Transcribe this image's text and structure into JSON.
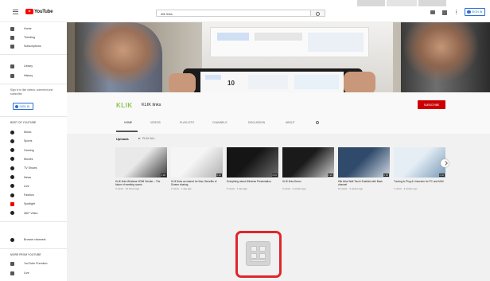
{
  "topbar": {
    "logo_text": "YouTube",
    "search_value": "klik links",
    "signin_label": "SIGN IN"
  },
  "sidebar": {
    "main_items": [
      {
        "label": "Home",
        "icon": "home-icon"
      },
      {
        "label": "Trending",
        "icon": "trending-icon"
      },
      {
        "label": "Subscriptions",
        "icon": "subscriptions-icon"
      }
    ],
    "library_items": [
      {
        "label": "Library",
        "icon": "library-icon"
      },
      {
        "label": "History",
        "icon": "history-icon"
      }
    ],
    "signin_prompt": "Sign in to like videos, comment and subscribe.",
    "signin_label": "SIGN IN",
    "best_heading": "BEST OF YOUTUBE",
    "best_items": [
      {
        "label": "Music",
        "icon": "music-icon"
      },
      {
        "label": "Sports",
        "icon": "sports-icon"
      },
      {
        "label": "Gaming",
        "icon": "gaming-icon"
      },
      {
        "label": "Movies",
        "icon": "movies-icon"
      },
      {
        "label": "TV Shows",
        "icon": "tv-shows-icon"
      },
      {
        "label": "News",
        "icon": "news-icon"
      },
      {
        "label": "Live",
        "icon": "live-icon"
      },
      {
        "label": "Fashion",
        "icon": "fashion-icon"
      },
      {
        "label": "Spotlight",
        "icon": "spotlight-icon"
      },
      {
        "label": "360° Video",
        "icon": "360-video-icon"
      }
    ],
    "browse_label": "Browse channels",
    "more_heading": "MORE FROM YOUTUBE",
    "more_items": [
      {
        "label": "YouTube Premium",
        "icon": "youtube-premium-icon"
      },
      {
        "label": "Live",
        "icon": "live-icon"
      }
    ]
  },
  "banner": {
    "tablet_number": "10"
  },
  "channel": {
    "logo_text": "KLIK",
    "name": "KLIK links",
    "subscribe_label": "SUBSCRIBE",
    "tabs": [
      "HOME",
      "VIDEOS",
      "PLAYLISTS",
      "CHANNELS",
      "DISCUSSION",
      "ABOUT"
    ]
  },
  "uploads": {
    "title": "Uploads",
    "play_all": "PLAY ALL",
    "videos": [
      {
        "title": "KLIK links Wireless HDMI Sender – The future of meeting rooms",
        "meta": "3 views · 10 hours ago",
        "duration": "1:03",
        "thumb_colors": [
          "#e9e9e9",
          "#3a3a3a"
        ]
      },
      {
        "title": "KLIK links as shared for Mac, Benefits of Screen sharing",
        "meta": "2 views · 1 day ago",
        "duration": "0:42",
        "thumb_colors": [
          "#f5f5f5",
          "#b0b0b0"
        ]
      },
      {
        "title": "Everything about Wireless Presentation",
        "meta": "5 views · 1 day ago",
        "duration": "0:31",
        "thumb_colors": [
          "#151515",
          "#6b6b6b"
        ]
      },
      {
        "title": "KLIK links Demo",
        "meta": "3 views · 2 weeks ago",
        "duration": "0:24",
        "thumb_colors": [
          "#1a1a1a",
          "#cfcfcf"
        ]
      },
      {
        "title": "Klik links Wall Touch Enabled with Back channel",
        "meta": "10 views · 3 weeks ago",
        "duration": "0:35",
        "thumb_colors": [
          "#2f4a6a",
          "#d0d8e2"
        ]
      },
      {
        "title": "Turning to Plug & Unscreen for PC and MAC",
        "meta": "7 views · 3 weeks ago",
        "duration": "0:40",
        "thumb_colors": [
          "#e6eef5",
          "#7a9ab8"
        ]
      }
    ]
  },
  "colors": {
    "brand_red": "#cc0000",
    "highlight_red": "#e0262a",
    "link_blue": "#2b6fd6",
    "channel_green": "#8bc34a"
  }
}
